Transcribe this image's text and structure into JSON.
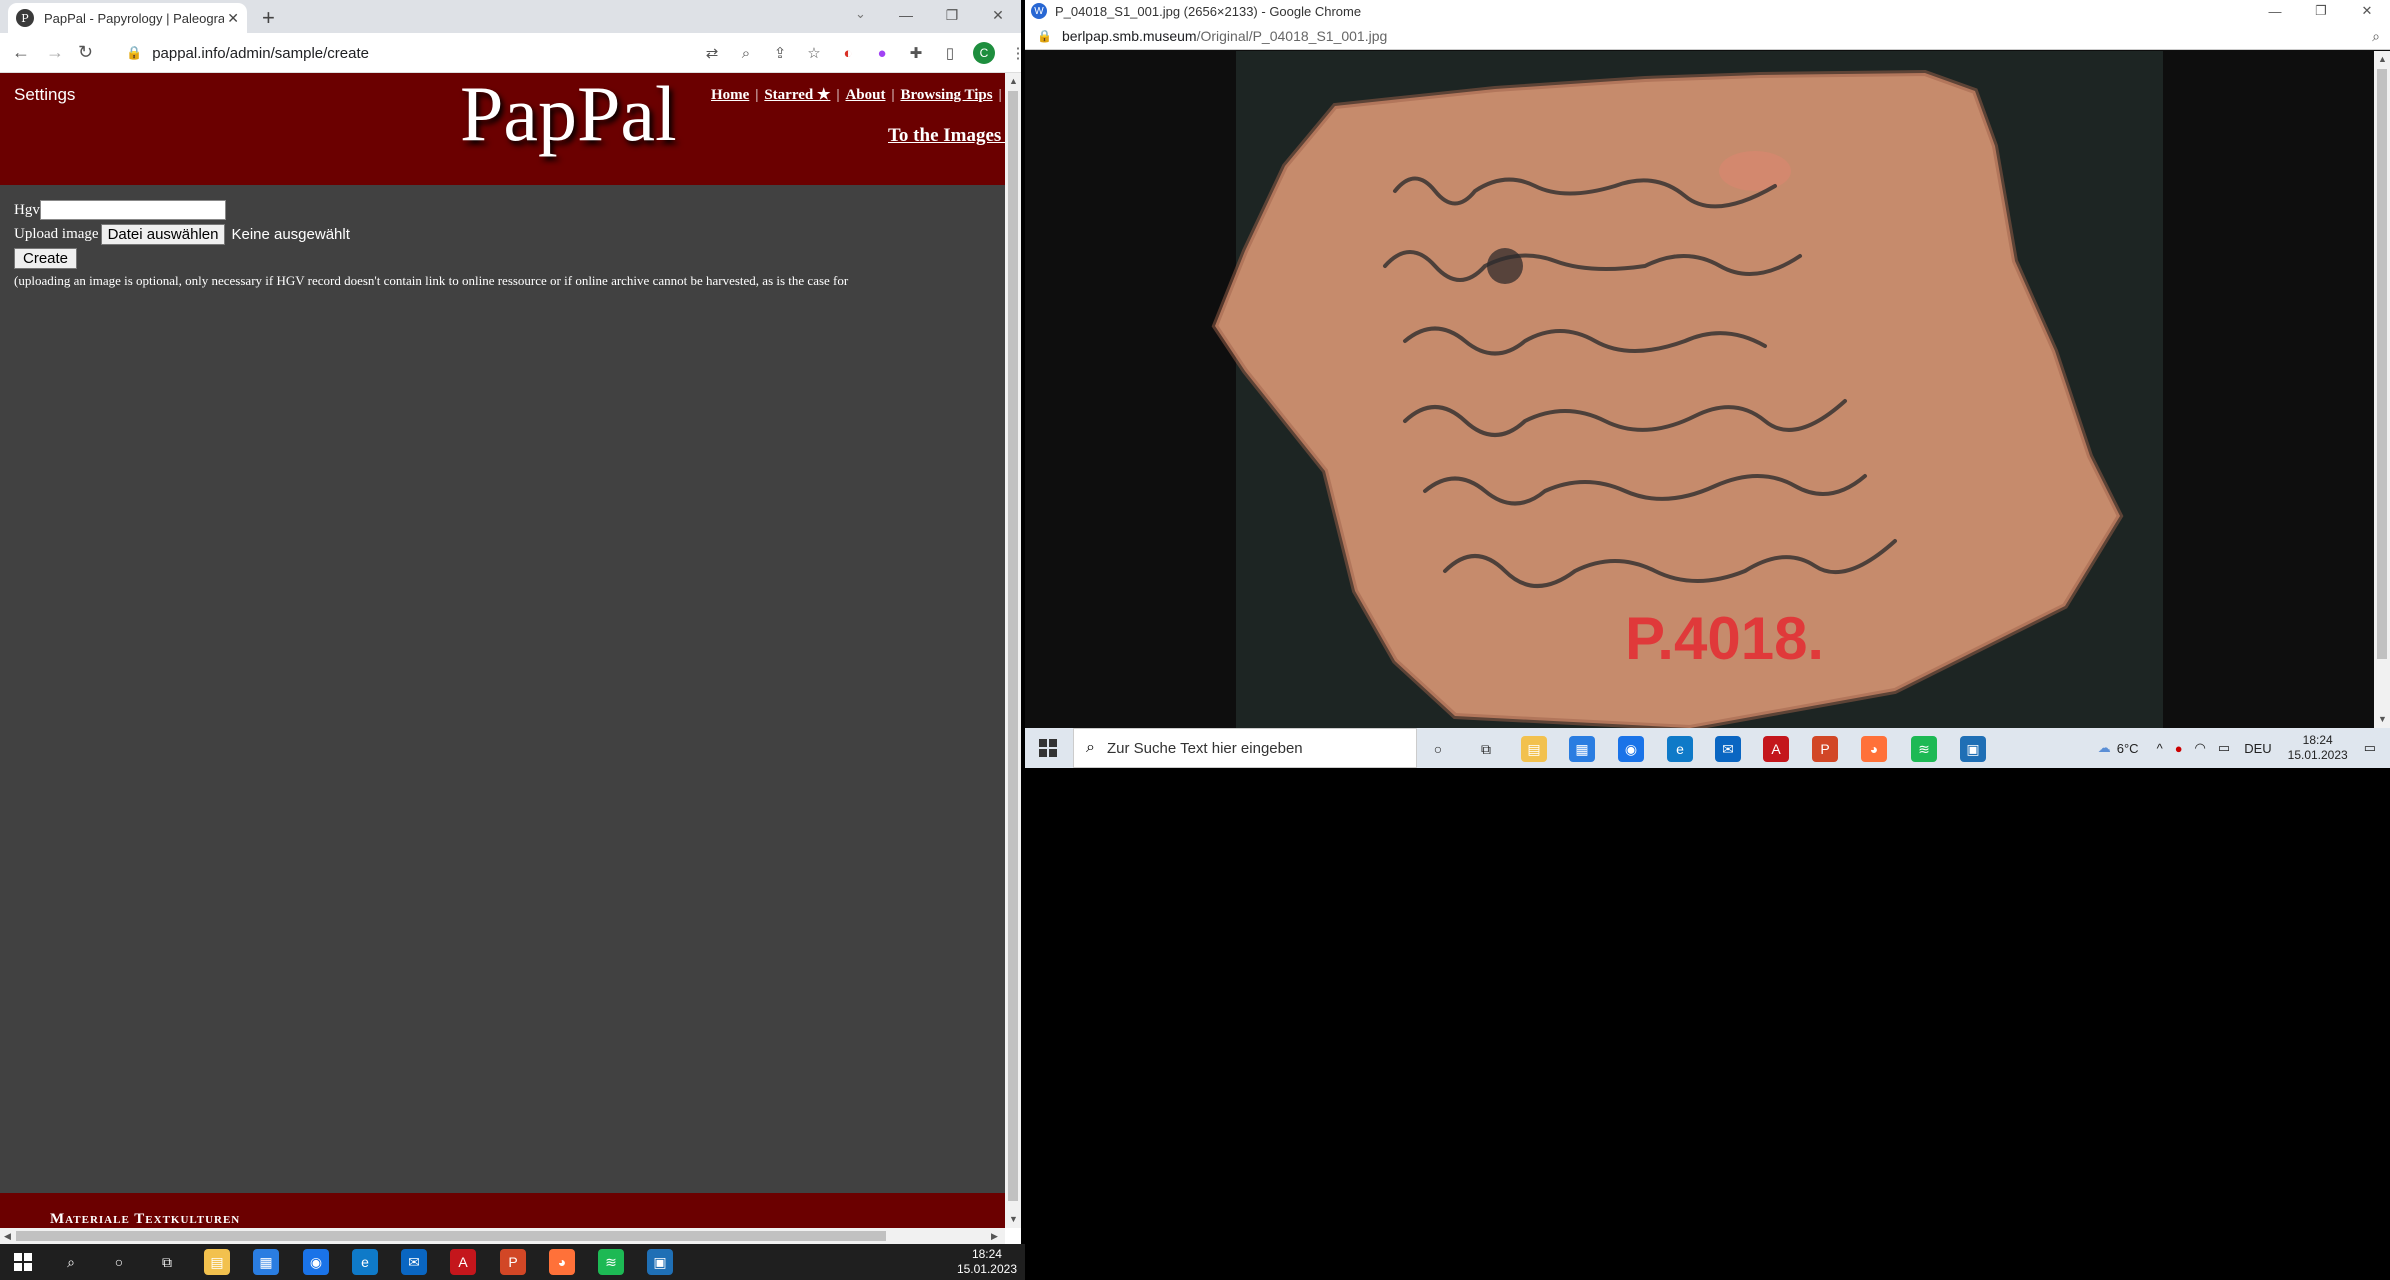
{
  "left_browser": {
    "tab_title": "PapPal - Papyrology | Paleography",
    "url": "pappal.info/admin/sample/create",
    "profile_initial": "C",
    "site": {
      "settings_label": "Settings",
      "logo": "PapPal",
      "nav": [
        "Home",
        "Starred ★",
        "About",
        "Browsing Tips"
      ],
      "to_images": "To the Images ..",
      "form": {
        "hgv_label": "Hgv",
        "upload_label": "Upload image",
        "file_button": "Datei auswählen",
        "file_status": "Keine ausgewählt",
        "create_button": "Create",
        "note": "(uploading an image is optional, only necessary if HGV record doesn't contain link to online ressource or if online archive cannot be harvested, as is the case for"
      },
      "footer_text": "Materiale Textkulturen"
    }
  },
  "right_browser": {
    "window_title": "P_04018_S1_001.jpg (2656×2133) - Google Chrome",
    "url_host": "berlpap.smb.museum",
    "url_path": "/Original/P_04018_S1_001.jpg",
    "ostracon_label": "P.4018."
  },
  "taskbar_right": {
    "search_placeholder": "Zur Suche Text hier eingeben",
    "temperature": "6°C",
    "language": "DEU",
    "time": "18:24",
    "date": "15.01.2023"
  },
  "taskbar_left": {
    "time": "18:24",
    "date": "15.01.2023"
  },
  "colors": {
    "site_header": "#6b0000",
    "site_background": "#414141",
    "shard": "#c68b6c",
    "stamp": "#e0393a"
  }
}
